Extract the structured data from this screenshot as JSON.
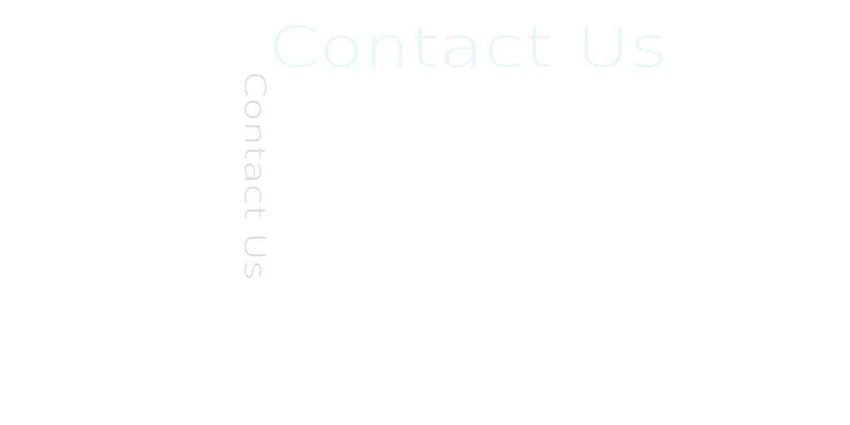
{
  "heading": {
    "title": "Contact Us",
    "vertical_title": "Contact Us",
    "title_color": "#e6f6fb",
    "vertical_title_color": "#d9d9d9"
  }
}
